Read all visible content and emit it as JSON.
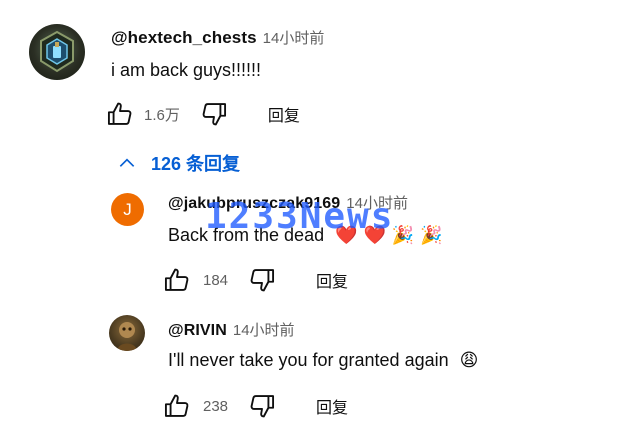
{
  "comment": {
    "author": "@hextech_chests",
    "time": "14小时前",
    "text": "i am back guys!!!!!!",
    "likes": "1.6万",
    "reply_label": "回复"
  },
  "replies_toggle": {
    "label": "126 条回复"
  },
  "replies": [
    {
      "avatar_letter": "J",
      "author": "@jakubpruszczak9169",
      "time": "14小时前",
      "text": "Back from the dead",
      "emojis": "❤️❤️🎉🎉",
      "likes": "184",
      "reply_label": "回复"
    },
    {
      "author": "@RIVIN",
      "time": "14小时前",
      "text": "I'll never take you for granted again",
      "emojis": "😩",
      "likes": "238",
      "reply_label": "回复"
    }
  ],
  "watermark": "1233News",
  "colors": {
    "link_blue": "#065fd4",
    "meta_gray": "#606060",
    "avatar_orange": "#ef6c00",
    "watermark_blue": "#1e5aff"
  },
  "icons": [
    "like-icon",
    "dislike-icon",
    "chevron-up-icon"
  ]
}
